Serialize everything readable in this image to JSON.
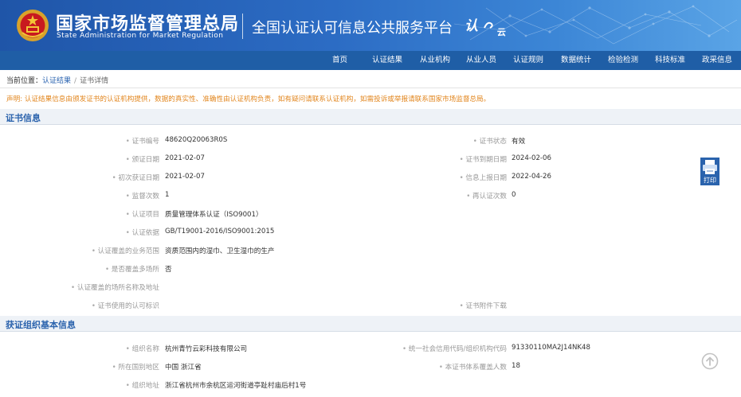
{
  "header": {
    "org_cn": "国家市场监督管理总局",
    "org_en": "State Administration  for  Market Regulation",
    "platform_title": "全国认证认可信息公共服务平台",
    "logo_text": "认",
    "logo_sub": "云",
    "emblem_icon": "national-emblem-icon"
  },
  "nav": {
    "items": [
      "首页",
      "认证结果",
      "从业机构",
      "从业人员",
      "认证规则",
      "数据统计",
      "检验检测",
      "科技标准",
      "政采信息"
    ]
  },
  "breadcrumb": {
    "prefix": "当前位置：",
    "link": "认证结果",
    "separator": "/",
    "current": "证书详情"
  },
  "notice": "声明: 认证结果信息由颁发证书的认证机构提供，数据的真实性、准确性由认证机构负责，如有疑问请联系认证机构，如需投诉或举报请联系国家市场监督总局。",
  "cert_section": {
    "title": "证书信息",
    "fields": {
      "cert_no_label": "证书编号",
      "cert_no": "48620Q20063R0S",
      "status_label": "证书状态",
      "status": "有效",
      "issue_date_label": "颁证日期",
      "issue_date": "2021-02-07",
      "expire_date_label": "证书到期日期",
      "expire_date": "2024-02-06",
      "first_date_label": "初次获证日期",
      "first_date": "2021-02-07",
      "report_date_label": "信息上报日期",
      "report_date": "2022-04-26",
      "supervision_label": "监督次数",
      "supervision": "1",
      "recert_label": "再认证次数",
      "recert": "0",
      "project_label": "认证项目",
      "project": "质量管理体系认证（ISO9001）",
      "basis_label": "认证依据",
      "basis": "GB/T19001-2016/ISO9001:2015",
      "scope_label": "认证覆盖的业务范围",
      "scope": "资质范围内的湿巾、卫生湿巾的生产",
      "multi_site_label": "是否覆盖多场所",
      "multi_site": "否",
      "site_addr_label": "认证覆盖的场所名称及地址",
      "mark_label": "证书使用的认可标识",
      "attachment_label": "证书附件下载"
    }
  },
  "org_section": {
    "title": "获证组织基本信息",
    "fields": {
      "name_label": "组织名称",
      "name": "杭州青竹云彩科技有限公司",
      "credit_code_label": "统一社会信用代码/组织机构代码",
      "credit_code": "91330110MA2J14NK48",
      "region_label": "所在国别地区",
      "region": "中国 浙江省",
      "headcount_label": "本证书体系覆盖人数",
      "headcount": "18",
      "address_label": "组织地址",
      "address": "浙江省杭州市余杭区运河街道亭趾村庙后村1号"
    }
  },
  "floating": {
    "print_label": "打印",
    "print_icon": "printer-icon",
    "top_icon": "back-to-top-icon"
  },
  "colors": {
    "header_blue": "#1f55a8",
    "nav_blue": "#1f5ea6",
    "section_title": "#2b63ad",
    "notice_orange": "#e2861e"
  }
}
